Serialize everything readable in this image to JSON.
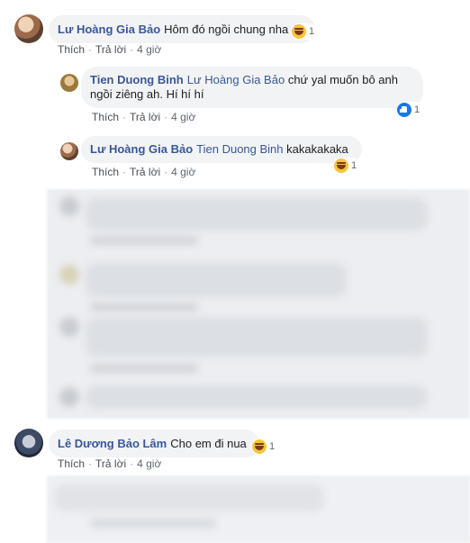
{
  "comment1": {
    "name": "Lư Hoàng Gia Bảo",
    "text": "Hôm đó ngồi chung nha",
    "reaction_count": "1",
    "like": "Thích",
    "reply": "Trả lời",
    "time": "4 giờ"
  },
  "reply1": {
    "name": "Tien Duong Binh",
    "mention": "Lư Hoàng Gia Bảo",
    "text_line1": "chứ yal muốn bô anh",
    "text_line2": "ngồi ziêng ah. Hí hí hí",
    "reaction_count": "1",
    "like": "Thích",
    "reply": "Trả lời",
    "time": "4 giờ"
  },
  "reply2": {
    "name": "Lư Hoàng Gia Bảo",
    "mention": "Tien Duong Binh",
    "text": "kakakakaka",
    "reaction_count": "1",
    "like": "Thích",
    "reply": "Trả lời",
    "time": "4 giờ"
  },
  "comment2": {
    "name": "Lê Dương Bảo Lâm",
    "text": "Cho em đi nua",
    "reaction_count": "1",
    "like": "Thích",
    "reply": "Trả lời",
    "time": "4 giờ"
  },
  "icons": {
    "haha": "haha-reaction",
    "like": "like-reaction"
  },
  "colors": {
    "name": "#385898",
    "bubble": "#f2f3f5",
    "meta": "#606770",
    "haha": "#f7c53a",
    "like": "#1877f2"
  }
}
